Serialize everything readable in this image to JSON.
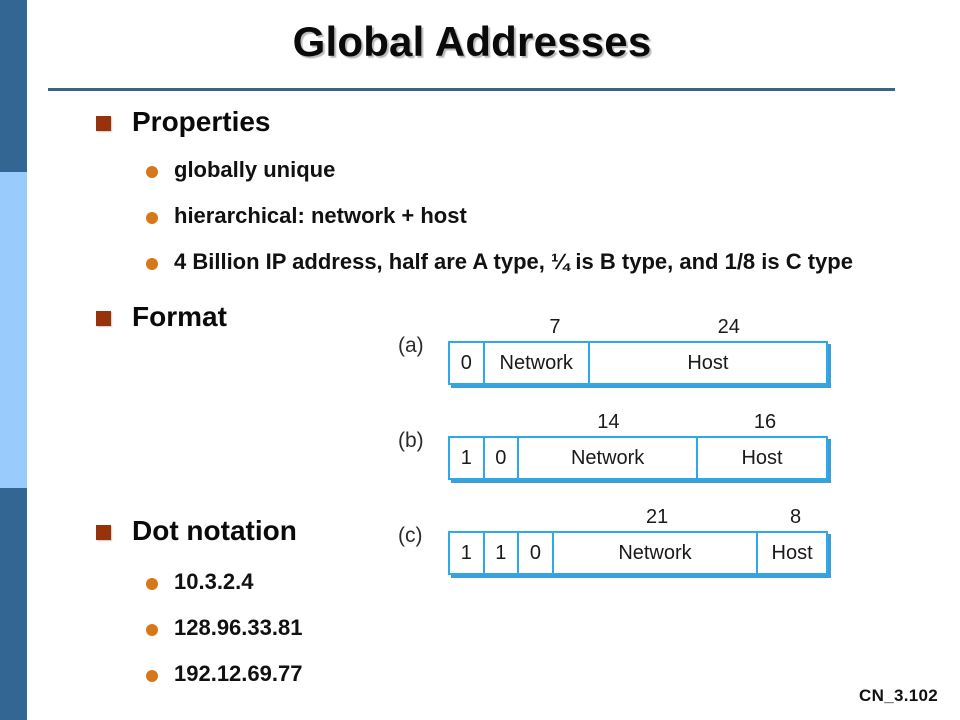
{
  "slide": {
    "title": "Global Addresses",
    "footer": "CN_3.102",
    "accent_rule_color": "#3b6480",
    "sidebar": {
      "dark_blue": "#346694",
      "light_blue": "#9acbfd"
    },
    "bullet_colors": {
      "square": "#96330a",
      "round": "#d8771a"
    }
  },
  "content": {
    "sections": [
      {
        "heading": "Properties",
        "items": [
          "globally unique",
          "hierarchical: network + host",
          "4 Billion IP address, half are A type, ¼ is B type, and 1/8 is C type"
        ]
      },
      {
        "heading": "Format",
        "items": []
      },
      {
        "heading": "Dot notation",
        "items": [
          "10.3.2.4",
          "128.96.33.81",
          "192.12.69.77"
        ]
      }
    ]
  },
  "figure": {
    "border_color": "#2ba9e8",
    "rows": [
      {
        "label": "(a)",
        "ticks": [
          {
            "text": "7",
            "left_pct": 9.0,
            "width_pct": 38.0
          },
          {
            "text": "24",
            "left_pct": 47.0,
            "width_pct": 53.0
          }
        ],
        "cells": [
          {
            "text": "0",
            "width_pct": 9.2
          },
          {
            "text": "Network",
            "width_pct": 28.0
          },
          {
            "text": "Host",
            "width_pct": 62.8
          }
        ]
      },
      {
        "label": "(b)",
        "ticks": [
          {
            "text": "14",
            "left_pct": 18.0,
            "width_pct": 48.0
          },
          {
            "text": "16",
            "left_pct": 66.0,
            "width_pct": 34.0
          }
        ],
        "cells": [
          {
            "text": "1",
            "width_pct": 9.2
          },
          {
            "text": "0",
            "width_pct": 9.2
          },
          {
            "text": "Network",
            "width_pct": 47.6
          },
          {
            "text": "Host",
            "width_pct": 34.0
          }
        ]
      },
      {
        "label": "(c)",
        "ticks": [
          {
            "text": "21",
            "left_pct": 27.5,
            "width_pct": 54.5
          },
          {
            "text": "8",
            "left_pct": 82.0,
            "width_pct": 18.0
          }
        ],
        "cells": [
          {
            "text": "1",
            "width_pct": 9.2
          },
          {
            "text": "1",
            "width_pct": 9.2
          },
          {
            "text": "0",
            "width_pct": 9.2
          },
          {
            "text": "Network",
            "width_pct": 54.4
          },
          {
            "text": "Host",
            "width_pct": 18.0
          }
        ]
      }
    ]
  }
}
